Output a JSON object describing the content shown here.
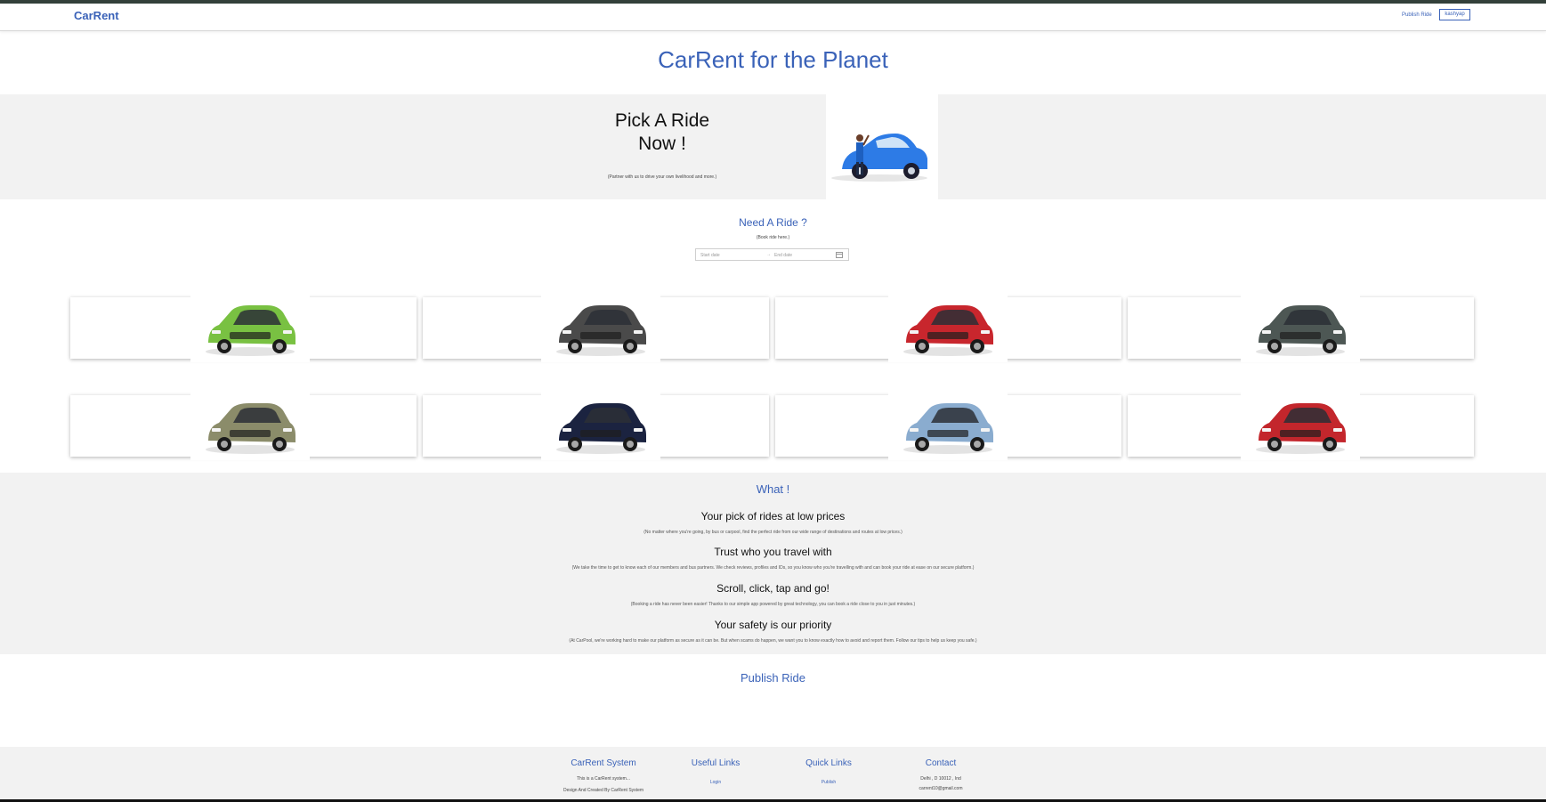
{
  "nav": {
    "brand": "CarRent",
    "publish_link": "Publish Ride",
    "user_button": "kashyap"
  },
  "main_title": "CarRent for the Planet",
  "hero": {
    "title_line1": "Pick A Ride",
    "title_line2": "Now !",
    "subtitle": "(Partner with us to drive your own livelihood and more.)"
  },
  "booking": {
    "title": "Need A Ride ?",
    "subtitle": "(Book ride here.)",
    "start_placeholder": "Start date",
    "separator": "→",
    "end_placeholder": "End date"
  },
  "cars": [
    {
      "color": "#79c142"
    },
    {
      "color": "#4a4a4a"
    },
    {
      "color": "#c8262d"
    },
    {
      "color": "#4d5754"
    },
    {
      "color": "#8b8c6a"
    },
    {
      "color": "#1b2340"
    },
    {
      "color": "#8aaccf"
    },
    {
      "color": "#c3262c"
    }
  ],
  "what": {
    "title": "What !",
    "features": [
      {
        "heading": "Your pick of rides at low prices",
        "text": "(No matter where you're going, by bus or carpool, find the perfect ride from our wide range of destinations and routes at low prices.)"
      },
      {
        "heading": "Trust who you travel with",
        "text": "(We take the time to get to know each of our members and bus partners. We check reviews, profiles and IDs, so you know who you're travelling with and can book your ride at ease on our secure platform.)"
      },
      {
        "heading": "Scroll, click, tap and go!",
        "text": "(Booking a ride has never been easier! Thanks to our simple app powered by great technology, you can book a ride close to you in just minutes.)"
      },
      {
        "heading": "Your safety is our priority",
        "text": "(At CarPool, we're working hard to make our platform as secure as it can be. But when scams do happen, we want you to know exactly how to avoid and report them. Follow our tips to help us keep you safe.)"
      }
    ]
  },
  "publish_title": "Publish Ride",
  "footer": {
    "system": {
      "title": "CarRent System",
      "line1": "This is a CarRent system...",
      "line2": "Design And Created By CarRent System"
    },
    "useful": {
      "title": "Useful Links",
      "link": "Login"
    },
    "quick": {
      "title": "Quick Links",
      "link": "Publish"
    },
    "contact": {
      "title": "Contact",
      "address": "Delhi , D 10012 , Ind",
      "email": "carrent10@gmail.com"
    }
  },
  "colors": {
    "accent": "#3a62b8",
    "section_bg": "#f2f2f2"
  }
}
